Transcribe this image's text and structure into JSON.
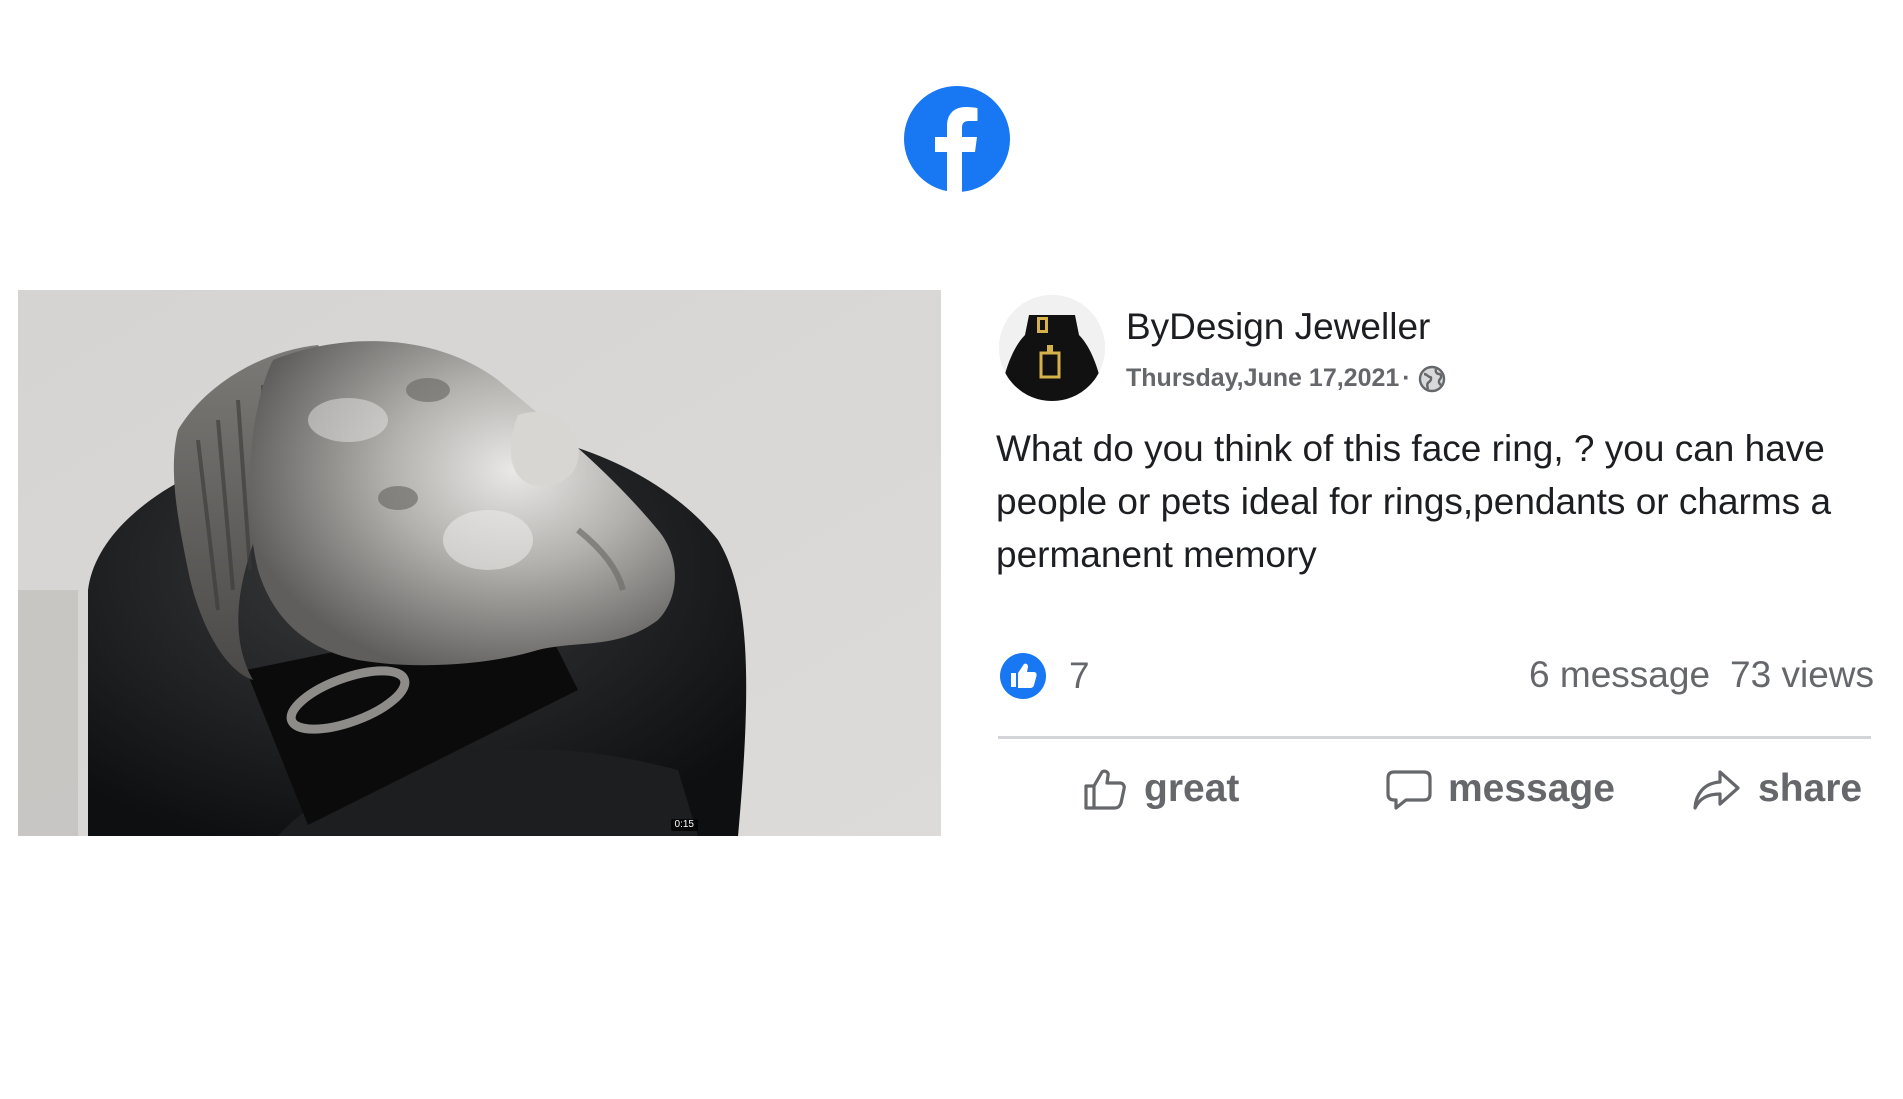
{
  "header": {
    "logo_icon": "facebook-logo-icon",
    "brand_color": "#1877f2"
  },
  "media": {
    "timestamp": "0:15"
  },
  "post": {
    "author": "ByDesign Jeweller",
    "date": "Thursday,June 17,2021",
    "separator": "·",
    "privacy_icon": "globe-icon",
    "text": "What do you think of this face ring, ? you can have people or pets ideal for rings,pendants or charms a permanent memory",
    "reactions": {
      "icon": "like-reaction-icon",
      "count": "7"
    },
    "stats": {
      "messages": "6 message",
      "views": "73 views"
    },
    "actions": {
      "great_label": "great",
      "message_label": "message",
      "share_label": "share"
    }
  }
}
